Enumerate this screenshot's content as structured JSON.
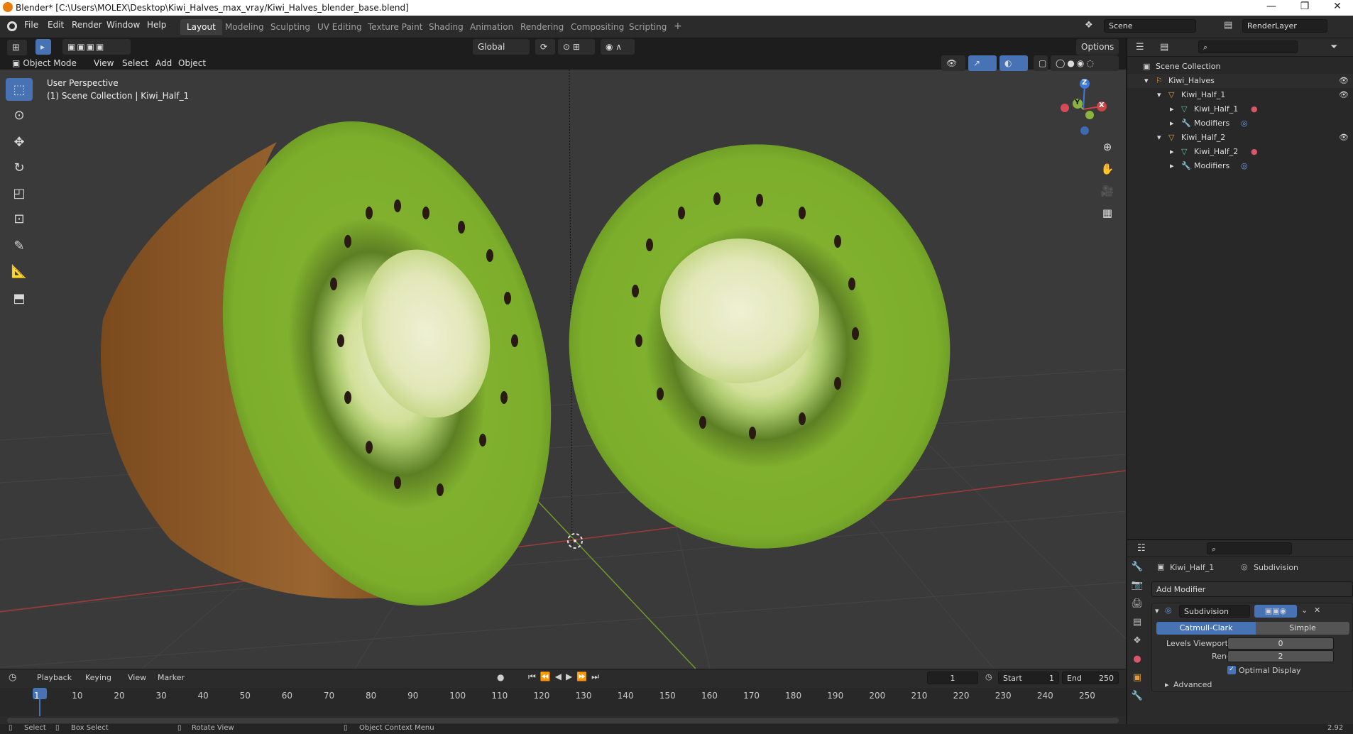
{
  "titlebar": {
    "title": "Blender* [C:\\Users\\MOLEX\\Desktop\\Kiwi_Halves_max_vray/Kiwi_Halves_blender_base.blend]",
    "minimize": "—",
    "restore": "❐",
    "close": "✕"
  },
  "menus": [
    "File",
    "Edit",
    "Render",
    "Window",
    "Help"
  ],
  "workspaces": [
    "Layout",
    "Modeling",
    "Sculpting",
    "UV Editing",
    "Texture Paint",
    "Shading",
    "Animation",
    "Rendering",
    "Compositing",
    "Scripting"
  ],
  "active_workspace": "Layout",
  "add_workspace": "+",
  "scene": {
    "name": "Scene",
    "render_layer": "RenderLayer"
  },
  "viewport_header": {
    "mode": "Object Mode",
    "menus": [
      "View",
      "Select",
      "Add",
      "Object"
    ],
    "orientation": "Global",
    "options": "Options"
  },
  "viewport_overlay": {
    "line1": "User Perspective",
    "line2": "(1) Scene Collection | Kiwi_Half_1"
  },
  "gizmo": {
    "z": "Z",
    "y": "Y",
    "x": "X"
  },
  "outliner": {
    "root": "Scene Collection",
    "items": [
      {
        "label": "Kiwi_Halves"
      },
      {
        "label": "Kiwi_Half_1"
      },
      {
        "label": "Kiwi_Half_1"
      },
      {
        "label": "Modifiers"
      },
      {
        "label": "Kiwi_Half_2"
      },
      {
        "label": "Kiwi_Half_2"
      },
      {
        "label": "Modifiers"
      }
    ]
  },
  "properties": {
    "object": "Kiwi_Half_1",
    "modifier_context": "Subdivision",
    "add_modifier": "Add Modifier",
    "modifier_name": "Subdivision",
    "catmull": "Catmull-Clark",
    "simple": "Simple",
    "levels_label": "Levels Viewport",
    "levels_value": "0",
    "render_label": "Render",
    "render_value": "2",
    "optimal": "Optimal Display",
    "advanced": "Advanced"
  },
  "timeline": {
    "menus": [
      "Playback",
      "Keying",
      "View",
      "Marker"
    ],
    "current_frame": "1",
    "start_label": "Start",
    "start": "1",
    "end_label": "End",
    "end": "250",
    "ticks": [
      "1",
      "10",
      "20",
      "30",
      "40",
      "50",
      "60",
      "70",
      "80",
      "90",
      "100",
      "110",
      "120",
      "130",
      "140",
      "150",
      "160",
      "170",
      "180",
      "190",
      "200",
      "210",
      "220",
      "230",
      "240",
      "250"
    ]
  },
  "statusbar": {
    "select": "Select",
    "box_select": "Box Select",
    "rotate": "Rotate View",
    "context": "Object Context Menu",
    "version": "2.92"
  },
  "colors": {
    "accent": "#4772b3",
    "viewport_bg": "#3a3a3a",
    "header": "#2b2b2b",
    "kiwi_flesh": "#7fb32a",
    "kiwi_skin": "#8a5a2b",
    "axis_x": "#b04444",
    "axis_y": "#6e9a2a"
  }
}
